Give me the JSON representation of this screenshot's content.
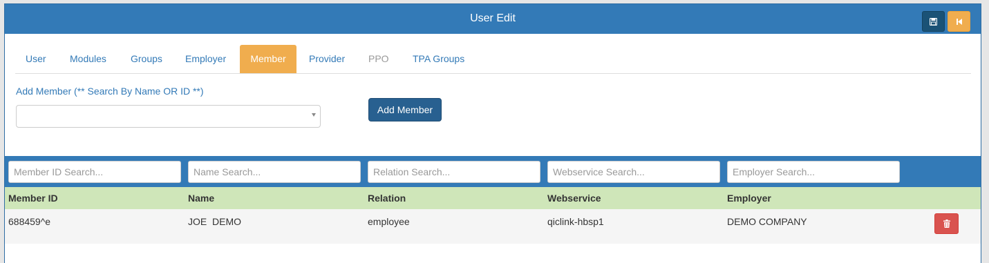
{
  "header": {
    "title": "User Edit",
    "save_icon": "save-icon",
    "back_icon": "step-backward-icon"
  },
  "tabs": [
    {
      "label": "User",
      "state": "normal"
    },
    {
      "label": "Modules",
      "state": "normal"
    },
    {
      "label": "Groups",
      "state": "normal"
    },
    {
      "label": "Employer",
      "state": "normal"
    },
    {
      "label": "Member",
      "state": "active"
    },
    {
      "label": "Provider",
      "state": "normal"
    },
    {
      "label": "PPO",
      "state": "disabled"
    },
    {
      "label": "TPA Groups",
      "state": "normal"
    }
  ],
  "add_member": {
    "label": "Add Member (** Search By Name OR ID **)",
    "select_value": "",
    "button_label": "Add Member"
  },
  "filters": {
    "member_id_placeholder": "Member ID Search...",
    "name_placeholder": "Name Search...",
    "relation_placeholder": "Relation Search...",
    "webservice_placeholder": "Webservice Search...",
    "employer_placeholder": "Employer Search..."
  },
  "table": {
    "columns": [
      "Member ID",
      "Name",
      "Relation",
      "Webservice",
      "Employer"
    ],
    "rows": [
      [
        "688459^e",
        "JOE  DEMO",
        "employee",
        "qiclink-hbsp1",
        "DEMO COMPANY"
      ]
    ],
    "delete_icon": "trash-icon"
  },
  "colors": {
    "primary": "#337ab7",
    "warning": "#f0ad4e",
    "danger": "#d9534f",
    "header_row": "#cfe6b9"
  }
}
